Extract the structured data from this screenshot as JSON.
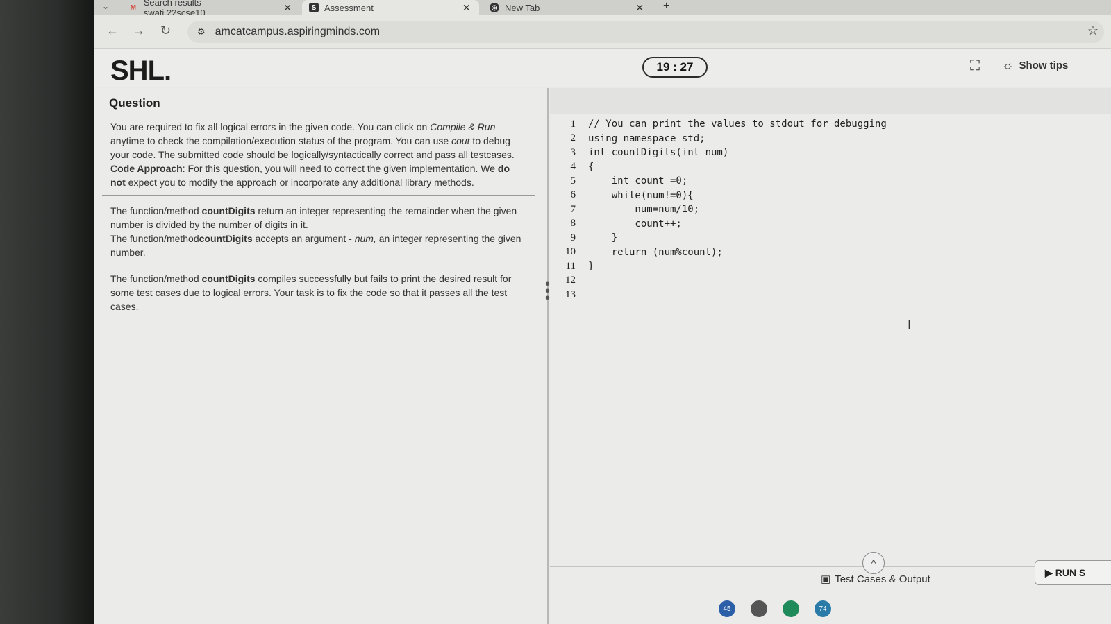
{
  "browser": {
    "tabs": [
      {
        "label": "Search results - swati.22scse10",
        "icon": "gmail-icon"
      },
      {
        "label": "Assessment",
        "icon": "shl-icon"
      },
      {
        "label": "New Tab",
        "icon": "newtab-icon"
      }
    ],
    "url": "amcatcampus.aspiringminds.com"
  },
  "header": {
    "logo": "SHL.",
    "timer": "19 : 27",
    "show_tips": "Show tips"
  },
  "question": {
    "title": "Question",
    "p1_a": "You are required to fix all logical errors in the given code. You can click on ",
    "p1_compile": "Compile & Run",
    "p1_b": " anytime to check the compilation/execution status of the program. You can use ",
    "p1_cout": "cout",
    "p1_c": " to debug your code. The submitted code should be logically/syntactically correct and pass all testcases.",
    "approach_label": "Code Approach",
    "approach_a": ": For this question, you will need to correct the given implementation. We ",
    "approach_donot": "do not",
    "approach_b": " expect you to modify the approach or incorporate any additional library methods.",
    "p2_a": "The function/method ",
    "p2_fn": "countDigits",
    "p2_b": " return an integer representing the remainder when the given number is divided by the number of digits in it.",
    "p3_a": "The function/method",
    "p3_fn": "countDigits",
    "p3_b": " accepts an argument - ",
    "p3_num": "num,",
    "p3_c": " an integer representing the given number.",
    "p4_a": "The function/method ",
    "p4_fn": "countDigits",
    "p4_b": " compiles successfully but fails to print the desired result for some test cases due to logical errors. Your task is to fix the code so that it passes all the test cases."
  },
  "editor": {
    "lines": [
      {
        "n": "1",
        "code": "// You can print the values to stdout for debugging"
      },
      {
        "n": "2",
        "code": "using namespace std;"
      },
      {
        "n": "3",
        "code": "int countDigits(int num)"
      },
      {
        "n": "4",
        "code": "{"
      },
      {
        "n": "5",
        "code": "    int count =0;"
      },
      {
        "n": "6",
        "code": "    while(num!=0){"
      },
      {
        "n": "7",
        "code": "        num=num/10;"
      },
      {
        "n": "8",
        "code": "        count++;"
      },
      {
        "n": "9",
        "code": "    }"
      },
      {
        "n": "10",
        "code": "    return (num%count);"
      },
      {
        "n": "11",
        "code": "}"
      },
      {
        "n": "12",
        "code": ""
      },
      {
        "n": "13",
        "code": ""
      }
    ]
  },
  "footer": {
    "test_cases": "Test Cases & Output",
    "run": "RUN S"
  },
  "taskbar": {
    "badges": [
      "45",
      "74"
    ]
  }
}
